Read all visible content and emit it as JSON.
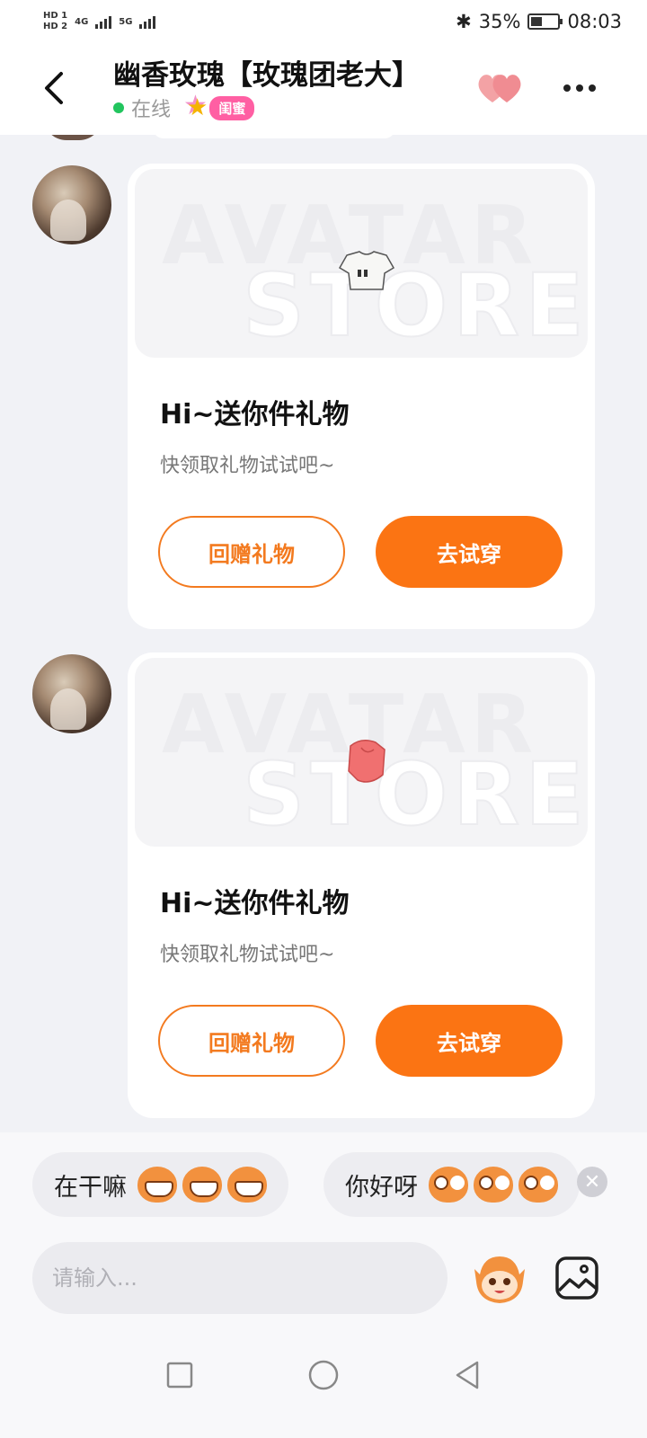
{
  "status_bar": {
    "hd1": "HD 1",
    "hd2": "HD 2",
    "net1": "4G",
    "net2": "5G",
    "battery_percent": "35%",
    "battery_level": 0.35,
    "time": "08:03"
  },
  "header": {
    "title": "幽香玫瑰【玫瑰团老大】",
    "online_text": "在线",
    "badge_label": "闺蜜"
  },
  "messages": [
    {
      "title": "Hi~送你件礼物",
      "subtitle": "快领取礼物试试吧~",
      "return_label": "回赠礼物",
      "try_label": "去试穿",
      "item_icon": "white-crop-top-icon",
      "watermark_top": "AVATAR",
      "watermark_bottom": "STORE"
    },
    {
      "title": "Hi~送你件礼物",
      "subtitle": "快领取礼物试试吧~",
      "return_label": "回赠礼物",
      "try_label": "去试穿",
      "item_icon": "red-shirt-icon",
      "watermark_top": "AVATAR",
      "watermark_bottom": "STORE"
    }
  ],
  "quick_replies": [
    {
      "text": "在干嘛"
    },
    {
      "text": "你好呀"
    }
  ],
  "input": {
    "placeholder": "请输入..."
  },
  "colors": {
    "accent": "#fb7413",
    "online": "#22c55e",
    "badge": "#ff5fa3",
    "background": "#f1f2f6"
  }
}
